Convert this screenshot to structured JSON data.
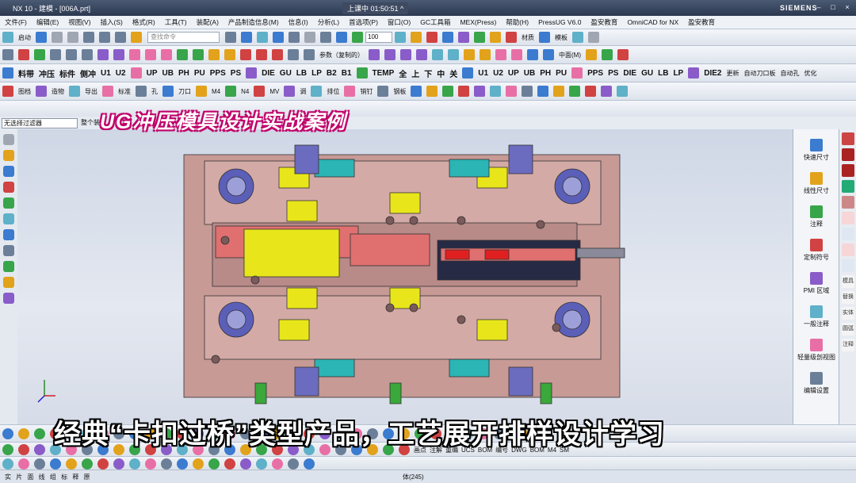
{
  "titlebar": {
    "title": "NX 10 - 建模 - [006A.prt]",
    "live_status": "上课中 01:50:51 ^",
    "brand": "SIEMENS",
    "controls": [
      "–",
      "□",
      "×"
    ]
  },
  "menubar": {
    "items": [
      "文件(F)",
      "编辑(E)",
      "视图(V)",
      "插入(S)",
      "格式(R)",
      "工具(T)",
      "装配(A)",
      "产品制造信息(M)",
      "信息(I)",
      "分析(L)",
      "首选项(P)",
      "窗口(O)",
      "GC工具箱",
      "MEX(Press)",
      "帮助(H)",
      "PressUG V6.0",
      "盈安教育",
      "OmniCAD for NX",
      "盈安教育"
    ]
  },
  "toolbar1": {
    "start_label": "启动",
    "search_placeholder": "查找命令",
    "zoom_value": "100",
    "labels": [
      "材质",
      "模板"
    ]
  },
  "toolbar2": {
    "labels": [
      "参数（复制的）",
      "中面(M)"
    ]
  },
  "toolbar3": {
    "buttons": [
      "料带",
      "冲压",
      "标件",
      "侧冲",
      "U1",
      "U2",
      "UP",
      "UB",
      "PH",
      "PU",
      "PPS",
      "PS",
      "DIE",
      "GU",
      "LB",
      "LP",
      "B2",
      "B1",
      "TEMP",
      "全",
      "上",
      "下",
      "中",
      "关",
      "U1",
      "U2",
      "UP",
      "UB",
      "PH",
      "PU",
      "PPS",
      "PS",
      "DIE",
      "GU",
      "LB",
      "LP",
      "DIE2"
    ],
    "extra": [
      "更新",
      "自动刀口板",
      "自动孔",
      "优化"
    ]
  },
  "toolbar4": {
    "labels": [
      "图档",
      "造物",
      "导出",
      "标准",
      "孔",
      "刀口",
      "M4",
      "N4",
      "MV",
      "调",
      "排位",
      "销钉",
      "钢板"
    ]
  },
  "filterbar": {
    "filter_value": "无选择过滤器",
    "assembly_value": "整个装"
  },
  "rightpanel": {
    "items": [
      "快速尺寸",
      "线性尺寸",
      "注释",
      "定制符号",
      "PMI 区域",
      "一般注释",
      "轻量级剖视图",
      "编辑设置"
    ]
  },
  "farright": {
    "items": [
      "模具",
      "替换",
      "实体",
      "圆弧",
      "注释"
    ]
  },
  "bottom_toolbar": {
    "labels": [
      "画点",
      "注解",
      "重编",
      "UCS",
      "BOM",
      "编号",
      "DWG",
      "BOM",
      "M4",
      "SM"
    ]
  },
  "statusbar": {
    "left": "实 片 面 线 组 标 释 原",
    "center": "体(245)"
  },
  "overlays": {
    "top_banner": "UG冲压模具设计实战案例",
    "bottom_banner": "经典“卡扣过桥”类型产品，工艺展开排样设计学习"
  },
  "colors": {
    "die_plate": "#c79a96",
    "insert_yellow": "#e8e61a",
    "guide_blue": "#5b5fb8",
    "strip_pink": "#e07070",
    "dark_bar": "#262a45",
    "banner_outline": "#c0006a"
  }
}
